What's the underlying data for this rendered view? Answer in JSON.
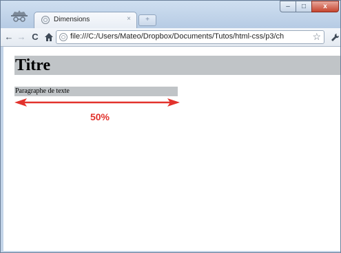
{
  "browser": {
    "tab": {
      "title": "Dimensions",
      "close_glyph": "×"
    },
    "new_tab_glyph": "+",
    "window_controls": {
      "minimize": "–",
      "maximize": "□",
      "close": "x"
    },
    "nav": {
      "back": "←",
      "forward": "→",
      "reload": "C",
      "home": "🏠",
      "wrench": "🔧"
    },
    "address_bar": {
      "url": "file:///C:/Users/Mateo/Dropbox/Documents/Tutos/html-css/p3/ch",
      "star": "☆"
    }
  },
  "page": {
    "heading": "Titre",
    "paragraph": "Paragraphe de texte",
    "annotation": {
      "label": "50%",
      "color": "#e2322c"
    }
  },
  "colors": {
    "block_background": "#c0c4c7",
    "annotation_red": "#e2322c"
  },
  "icons": [
    "incognito-icon",
    "page-icon",
    "star-icon",
    "wrench-icon"
  ]
}
